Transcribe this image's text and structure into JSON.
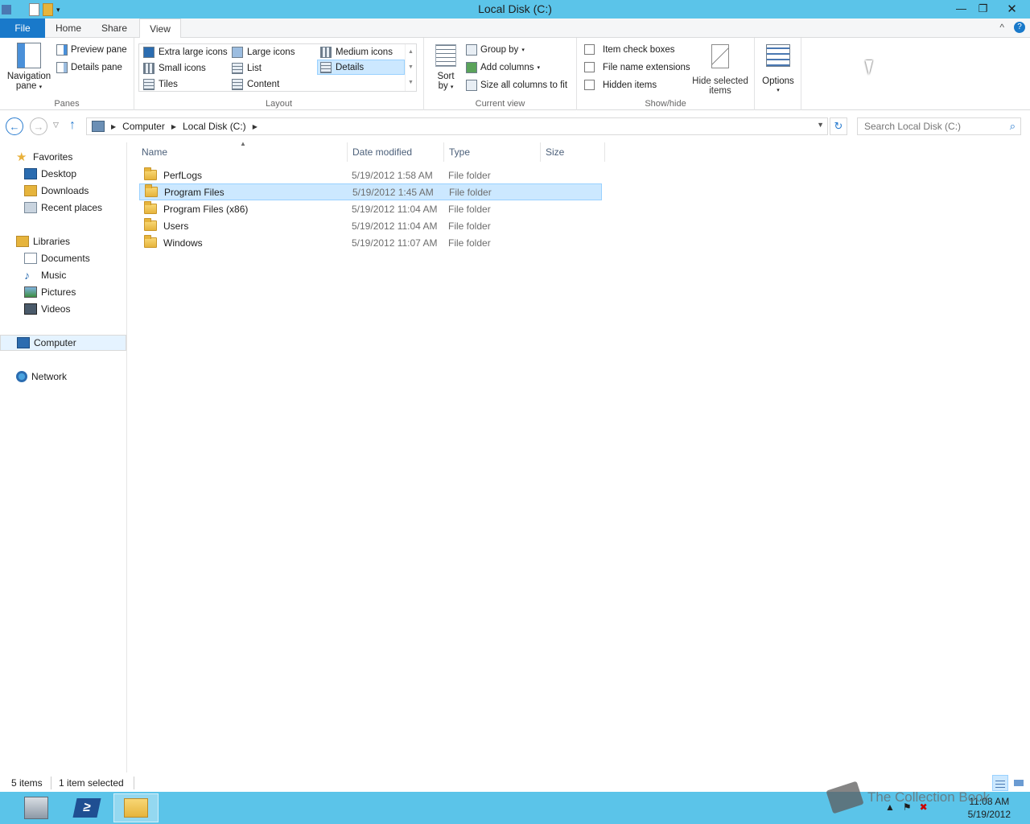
{
  "window": {
    "title": "Local Disk (C:)",
    "minimize_glyph": "—",
    "maximize_glyph": "❐",
    "close_glyph": "✕"
  },
  "ribbon_tabs": {
    "file": "File",
    "home": "Home",
    "share": "Share",
    "view": "View",
    "collapse_glyph": "^",
    "help_glyph": "?"
  },
  "ribbon": {
    "panes": {
      "label": "Panes",
      "navigation_pane": "Navigation",
      "navigation_pane_2": "pane",
      "preview_pane": "Preview pane",
      "details_pane": "Details pane"
    },
    "layout": {
      "label": "Layout",
      "extra_large_icons": "Extra large icons",
      "large_icons": "Large icons",
      "medium_icons": "Medium icons",
      "small_icons": "Small icons",
      "list": "List",
      "details": "Details",
      "tiles": "Tiles",
      "content": "Content"
    },
    "current_view": {
      "label": "Current view",
      "sort_by": "Sort",
      "sort_by_2": "by",
      "group_by": "Group by",
      "add_columns": "Add columns",
      "size_all_columns": "Size all columns to fit"
    },
    "show_hide": {
      "label": "Show/hide",
      "item_check_boxes": "Item check boxes",
      "file_name_extensions": "File name extensions",
      "hidden_items": "Hidden items",
      "hide_selected_items": "Hide selected",
      "hide_selected_items_2": "items"
    },
    "options": {
      "label": "Options"
    }
  },
  "address_bar": {
    "crumbs": [
      "Computer",
      "Local Disk (C:)"
    ],
    "search_placeholder": "Search Local Disk (C:)"
  },
  "nav_pane": {
    "favorites": "Favorites",
    "favorites_items": [
      "Desktop",
      "Downloads",
      "Recent places"
    ],
    "libraries": "Libraries",
    "libraries_items": [
      "Documents",
      "Music",
      "Pictures",
      "Videos"
    ],
    "computer": "Computer",
    "network": "Network"
  },
  "file_list": {
    "columns": [
      "Name",
      "Date modified",
      "Type",
      "Size"
    ],
    "rows": [
      {
        "name": "PerfLogs",
        "date": "5/19/2012 1:58 AM",
        "type": "File folder"
      },
      {
        "name": "Program Files",
        "date": "5/19/2012 1:45 AM",
        "type": "File folder"
      },
      {
        "name": "Program Files (x86)",
        "date": "5/19/2012 11:04 AM",
        "type": "File folder"
      },
      {
        "name": "Users",
        "date": "5/19/2012 11:04 AM",
        "type": "File folder"
      },
      {
        "name": "Windows",
        "date": "5/19/2012 11:07 AM",
        "type": "File folder"
      }
    ],
    "selected_index": 1
  },
  "status_bar": {
    "item_count": "5 items",
    "selected_count": "1 item selected"
  },
  "taskbar": {
    "powershell_glyph": "≥",
    "clock_time": "11:08 AM",
    "clock_date": "5/19/2012"
  },
  "watermark": "The Collection Book",
  "colors": {
    "titlebar": "#5bc4e9",
    "file_tab": "#1979ca",
    "selection": "#cce8ff",
    "selection_border": "#99d1ff"
  }
}
